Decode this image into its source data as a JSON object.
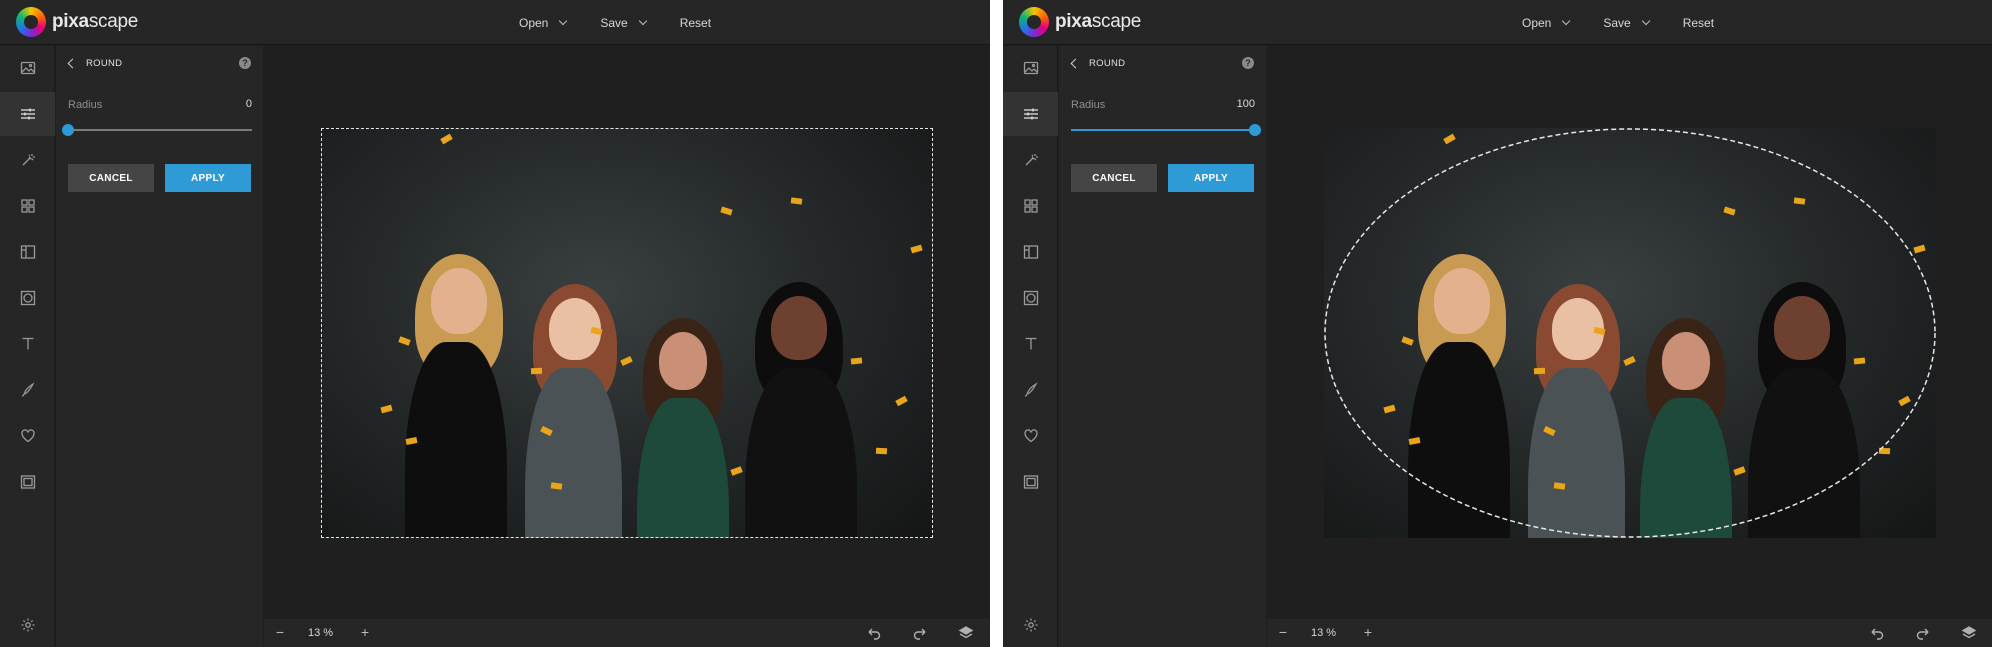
{
  "brand": {
    "name_bold": "pixa",
    "name_regular": "scape",
    "icon": "pixascape-logo-mark"
  },
  "colors": {
    "accent": "#2f9bd6",
    "background": "#1f1f1f",
    "panel": "#262626",
    "cancel_button": "#454545",
    "confetti": "#e9a51a"
  },
  "topbar": {
    "open_label": "Open",
    "save_label": "Save",
    "reset_label": "Reset"
  },
  "rail_icons": [
    "image-icon",
    "adjust-sliders-icon",
    "magic-wand-icon",
    "grid-icon",
    "frame-layout-icon",
    "vignette-icon",
    "text-icon",
    "brush-icon",
    "heart-icon",
    "border-icon",
    "settings-icon"
  ],
  "screens": [
    {
      "panel": {
        "title": "ROUND",
        "help": "?",
        "radius_label": "Radius",
        "radius_value": "0",
        "radius_fraction": 0,
        "cancel_label": "CANCEL",
        "apply_label": "APPLY"
      },
      "zoom": {
        "level": "13 %",
        "minus": "−",
        "plus": "+"
      },
      "selection_shape": "rectangle"
    },
    {
      "panel": {
        "title": "ROUND",
        "help": "?",
        "radius_label": "Radius",
        "radius_value": "100",
        "radius_fraction": 1,
        "cancel_label": "CANCEL",
        "apply_label": "APPLY"
      },
      "zoom": {
        "level": "13 %",
        "minus": "−",
        "plus": "+"
      },
      "selection_shape": "ellipse"
    }
  ],
  "bottombar_icons": [
    "undo-icon",
    "redo-icon",
    "layers-icon"
  ]
}
